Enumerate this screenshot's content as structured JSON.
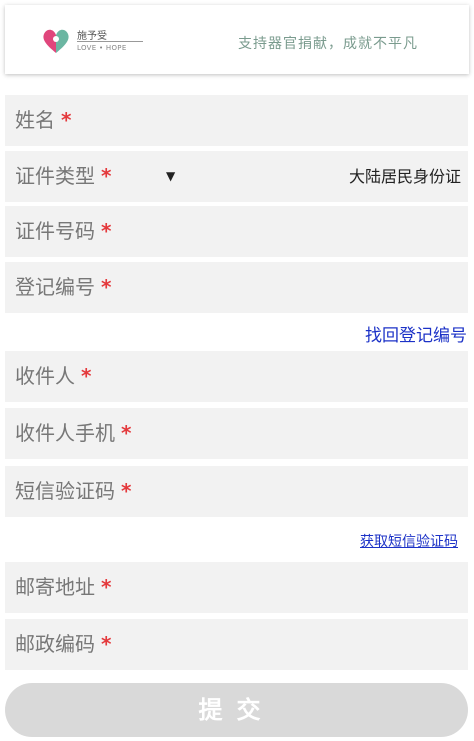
{
  "header": {
    "logo_cn": "施予受",
    "logo_en": "LOVE • HOPE",
    "slogan": "支持器官捐献，成就不平凡"
  },
  "form": {
    "name_label": "姓名",
    "id_type_label": "证件类型",
    "id_type_value": "大陆居民身份证",
    "id_number_label": "证件号码",
    "reg_number_label": "登记编号",
    "recover_link": "找回登记编号",
    "recipient_label": "收件人",
    "recipient_phone_label": "收件人手机",
    "sms_code_label": "短信验证码",
    "get_sms_link": "获取短信验证码",
    "address_label": "邮寄地址",
    "postcode_label": "邮政编码",
    "required_mark": "*",
    "dropdown_arrow": "▼"
  },
  "submit_label": "提交"
}
